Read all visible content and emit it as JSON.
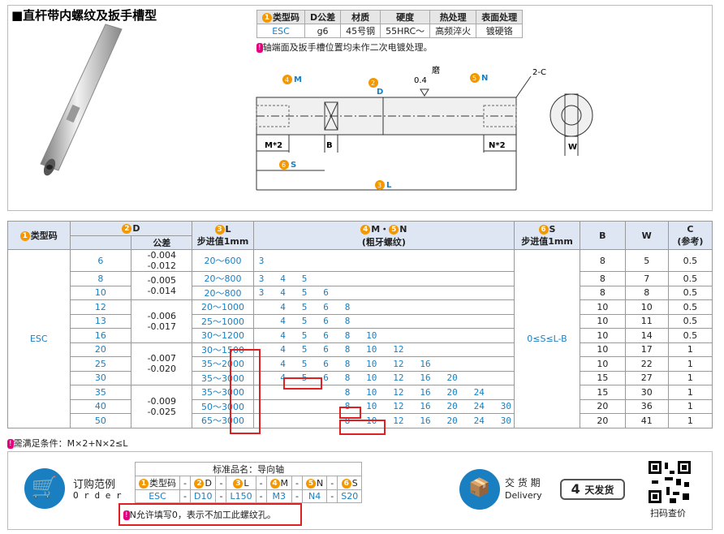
{
  "title": "■直杆带内螺纹及扳手槽型",
  "spec": {
    "headers": [
      "类型码",
      "D公差",
      "材质",
      "硬度",
      "热处理",
      "表面处理"
    ],
    "header_nums": [
      "1",
      "",
      "",
      "",
      "",
      ""
    ],
    "row": [
      "ESC",
      "g6",
      "45号钢",
      "55HRC～",
      "高频淬火",
      "镀硬铬"
    ]
  },
  "note_pill": "!",
  "note1": "轴端面及扳手槽位置均未作二次电镀处理。",
  "drawing": {
    "m_label": "M",
    "n_label": "N",
    "d_label": "D",
    "grind": "磨",
    "grind_val": "0.4",
    "chamfer": "2-C",
    "mx2": "M*2",
    "nx2": "N*2",
    "b": "B",
    "s": "S",
    "l": "L",
    "w": "W",
    "n2": "2",
    "n3": "3",
    "n4": "4",
    "n5": "5",
    "n6": "6"
  },
  "table": {
    "h_type": "类型码",
    "h_d": "D",
    "h_tol": "公差",
    "h_l": "L",
    "h_l_sub": "步进值1mm",
    "h_mn": "M・N",
    "h_mn_sub": "(粗牙螺纹)",
    "h_s": "S",
    "h_s_sub": "步进值1mm",
    "h_b": "B",
    "h_w": "W",
    "h_c": "C",
    "h_c_sub": "(参考)",
    "type": "ESC",
    "s_range": "0≤S≤L-B",
    "rows": [
      {
        "d": "6",
        "tol": "-0.004\n-0.012",
        "l": "20～600",
        "mn": "3",
        "b": "8",
        "w": "5",
        "c": "0.5"
      },
      {
        "d": "8",
        "tol": "-0.005\n-0.014",
        "l": "20～800",
        "mn": "3   4   5",
        "b": "8",
        "w": "7",
        "c": "0.5"
      },
      {
        "d": "10",
        "tol": "",
        "l": "20～800",
        "mn": "3   4   5   6",
        "b": "8",
        "w": "8",
        "c": "0.5"
      },
      {
        "d": "12",
        "tol": "-0.006\n-0.017",
        "l": "20～1000",
        "mn": "    4   5   6   8",
        "b": "10",
        "w": "10",
        "c": "0.5"
      },
      {
        "d": "13",
        "tol": "",
        "l": "25～1000",
        "mn": "    4   5   6   8",
        "b": "10",
        "w": "11",
        "c": "0.5"
      },
      {
        "d": "16",
        "tol": "",
        "l": "30～1200",
        "mn": "    4   5   6   8   10",
        "b": "10",
        "w": "14",
        "c": "0.5"
      },
      {
        "d": "20",
        "tol": "-0.007\n-0.020",
        "l": "30～1500",
        "mn": "    4   5   6   8   10   12",
        "b": "10",
        "w": "17",
        "c": "1"
      },
      {
        "d": "25",
        "tol": "",
        "l": "35～2000",
        "mn": "    4   5   6   8   10   12   16",
        "b": "10",
        "w": "22",
        "c": "1"
      },
      {
        "d": "30",
        "tol": "",
        "l": "35～3000",
        "mn": "    4   5   6   8   10   12   16   20",
        "b": "15",
        "w": "27",
        "c": "1"
      },
      {
        "d": "35",
        "tol": "-0.009\n-0.025",
        "l": "35～3000",
        "mn": "                8   10   12   16   20   24",
        "b": "15",
        "w": "30",
        "c": "1"
      },
      {
        "d": "40",
        "tol": "",
        "l": "50～3000",
        "mn": "                8   10   12   16   20   24   30",
        "b": "20",
        "w": "36",
        "c": "1"
      },
      {
        "d": "50",
        "tol": "",
        "l": "65～3000",
        "mn": "                8   10   12   16   20   24   30",
        "b": "20",
        "w": "41",
        "c": "1"
      }
    ]
  },
  "footnote": "需满足条件：M×2+N×2≤L",
  "order": {
    "label_cn": "订购范例",
    "label_en": "O r d e r",
    "cap": "标准品名：导向轴",
    "cols": [
      "类型码",
      "D",
      "L",
      "M",
      "N",
      "S"
    ],
    "vals": [
      "ESC",
      "D10",
      "L150",
      "M3",
      "N4",
      "S20"
    ],
    "dash": "-",
    "note": "N允许填写0，表示不加工此螺纹孔。"
  },
  "delivery": {
    "cn": "交 货 期",
    "en": "Delivery",
    "days": "4",
    "unit": "天发货"
  },
  "qr": "扫码查价"
}
